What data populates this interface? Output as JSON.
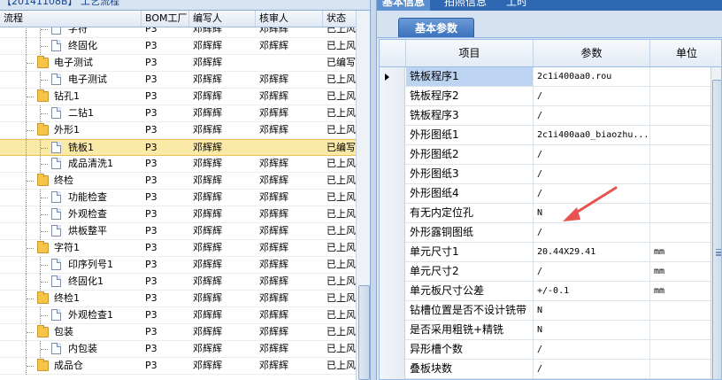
{
  "left_panel": {
    "top_tag": "【20141108B】 工艺流程",
    "columns": [
      "流程",
      "BOM工厂",
      "编写人",
      "核审人",
      "状态"
    ],
    "rows": [
      {
        "level": 2,
        "kind": "doc",
        "name": "字符",
        "bom": "P3",
        "writer": "邓辉辉",
        "reviewer": "邓辉辉",
        "status": "已上风",
        "selected": false
      },
      {
        "level": 2,
        "kind": "doc",
        "name": "终固化",
        "bom": "P3",
        "writer": "邓辉辉",
        "reviewer": "邓辉辉",
        "status": "已上风",
        "selected": false
      },
      {
        "level": 1,
        "kind": "folder",
        "name": "电子测试",
        "bom": "P3",
        "writer": "邓辉辉",
        "reviewer": "",
        "status": "已编写",
        "selected": false
      },
      {
        "level": 2,
        "kind": "doc",
        "name": "电子测试",
        "bom": "P3",
        "writer": "邓辉辉",
        "reviewer": "邓辉辉",
        "status": "已上风",
        "selected": false
      },
      {
        "level": 1,
        "kind": "folder",
        "name": "钻孔1",
        "bom": "P3",
        "writer": "邓辉辉",
        "reviewer": "邓辉辉",
        "status": "已上风",
        "selected": false
      },
      {
        "level": 2,
        "kind": "doc",
        "name": "二钻1",
        "bom": "P3",
        "writer": "邓辉辉",
        "reviewer": "邓辉辉",
        "status": "已上风",
        "selected": false
      },
      {
        "level": 1,
        "kind": "folder",
        "name": "外形1",
        "bom": "P3",
        "writer": "邓辉辉",
        "reviewer": "邓辉辉",
        "status": "已上风",
        "selected": false
      },
      {
        "level": 2,
        "kind": "doc",
        "name": "铣板1",
        "bom": "P3",
        "writer": "邓辉辉",
        "reviewer": "",
        "status": "已编写",
        "selected": true
      },
      {
        "level": 2,
        "kind": "doc",
        "name": "成品清洗1",
        "bom": "P3",
        "writer": "邓辉辉",
        "reviewer": "邓辉辉",
        "status": "已上风",
        "selected": false
      },
      {
        "level": 1,
        "kind": "folder",
        "name": "终检",
        "bom": "P3",
        "writer": "邓辉辉",
        "reviewer": "邓辉辉",
        "status": "已上风",
        "selected": false
      },
      {
        "level": 2,
        "kind": "doc",
        "name": "功能检查",
        "bom": "P3",
        "writer": "邓辉辉",
        "reviewer": "邓辉辉",
        "status": "已上风",
        "selected": false
      },
      {
        "level": 2,
        "kind": "doc",
        "name": "外观检查",
        "bom": "P3",
        "writer": "邓辉辉",
        "reviewer": "邓辉辉",
        "status": "已上风",
        "selected": false
      },
      {
        "level": 2,
        "kind": "doc",
        "name": "烘板整平",
        "bom": "P3",
        "writer": "邓辉辉",
        "reviewer": "邓辉辉",
        "status": "已上风",
        "selected": false
      },
      {
        "level": 1,
        "kind": "folder",
        "name": "字符1",
        "bom": "P3",
        "writer": "邓辉辉",
        "reviewer": "邓辉辉",
        "status": "已上风",
        "selected": false
      },
      {
        "level": 2,
        "kind": "doc",
        "name": "印序列号1",
        "bom": "P3",
        "writer": "邓辉辉",
        "reviewer": "邓辉辉",
        "status": "已上风",
        "selected": false
      },
      {
        "level": 2,
        "kind": "doc",
        "name": "终固化1",
        "bom": "P3",
        "writer": "邓辉辉",
        "reviewer": "邓辉辉",
        "status": "已上风",
        "selected": false
      },
      {
        "level": 1,
        "kind": "folder",
        "name": "终检1",
        "bom": "P3",
        "writer": "邓辉辉",
        "reviewer": "邓辉辉",
        "status": "已上风",
        "selected": false
      },
      {
        "level": 2,
        "kind": "doc",
        "name": "外观检查1",
        "bom": "P3",
        "writer": "邓辉辉",
        "reviewer": "邓辉辉",
        "status": "已上风",
        "selected": false
      },
      {
        "level": 1,
        "kind": "folder",
        "name": "包装",
        "bom": "P3",
        "writer": "邓辉辉",
        "reviewer": "邓辉辉",
        "status": "已上风",
        "selected": false
      },
      {
        "level": 2,
        "kind": "doc",
        "name": "内包装",
        "bom": "P3",
        "writer": "邓辉辉",
        "reviewer": "邓辉辉",
        "status": "已上风",
        "selected": false
      },
      {
        "level": 1,
        "kind": "folder",
        "name": "成品仓",
        "bom": "P3",
        "writer": "邓辉辉",
        "reviewer": "邓辉辉",
        "status": "已上风",
        "selected": false
      }
    ]
  },
  "right_panel": {
    "top_tabs": [
      "基本信息",
      "拍照信息",
      "工时"
    ],
    "sub_tab": "基本参数",
    "grid_columns": [
      "项目",
      "参数",
      "单位"
    ],
    "rows": [
      {
        "item": "铣板程序1",
        "param": "2c1i400aa0.rou",
        "unit": "",
        "selected": true
      },
      {
        "item": "铣板程序2",
        "param": "/",
        "unit": "",
        "selected": false
      },
      {
        "item": "铣板程序3",
        "param": "/",
        "unit": "",
        "selected": false
      },
      {
        "item": "外形图纸1",
        "param": "2c1i400aa0_biaozhu...",
        "unit": "",
        "selected": false
      },
      {
        "item": "外形图纸2",
        "param": "/",
        "unit": "",
        "selected": false
      },
      {
        "item": "外形图纸3",
        "param": "/",
        "unit": "",
        "selected": false
      },
      {
        "item": "外形图纸4",
        "param": "/",
        "unit": "",
        "selected": false
      },
      {
        "item": "有无内定位孔",
        "param": "N",
        "unit": "",
        "selected": false
      },
      {
        "item": "外形露铜图纸",
        "param": "/",
        "unit": "",
        "selected": false
      },
      {
        "item": "单元尺寸1",
        "param": "20.44X29.41",
        "unit": "mm",
        "selected": false
      },
      {
        "item": "单元尺寸2",
        "param": "/",
        "unit": "mm",
        "selected": false
      },
      {
        "item": "单元板尺寸公差",
        "param": "+/-0.1",
        "unit": "mm",
        "selected": false
      },
      {
        "item": "钻槽位置是否不设计铣带",
        "param": "N",
        "unit": "",
        "selected": false
      },
      {
        "item": "是否采用粗铣+精铣",
        "param": "N",
        "unit": "",
        "selected": false
      },
      {
        "item": "异形槽个数",
        "param": "/",
        "unit": "",
        "selected": false
      },
      {
        "item": "叠板块数",
        "param": "/",
        "unit": "",
        "selected": false
      }
    ]
  },
  "colors": {
    "selection": "#fbe9a8",
    "header_blue": "#2e68b3",
    "annotation_arrow": "#e8524f"
  }
}
